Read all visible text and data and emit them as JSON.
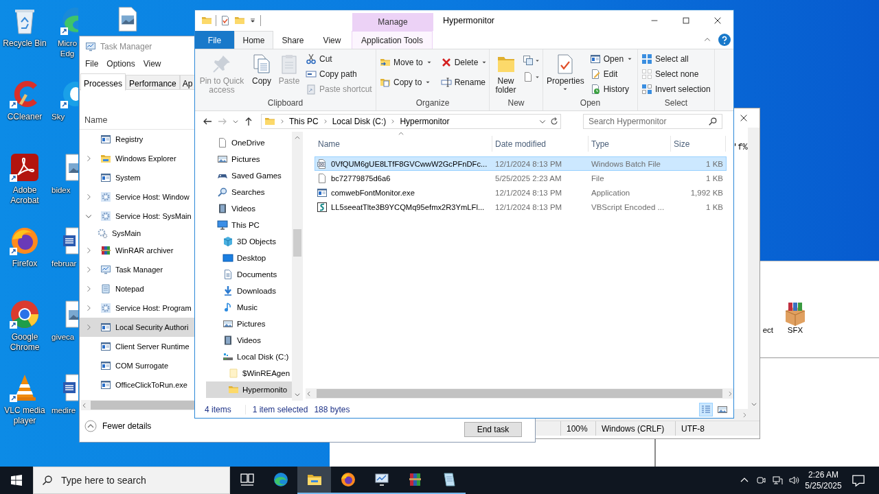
{
  "desktop": {
    "icons": [
      {
        "label": "Recycle Bin"
      },
      {
        "label": "CCleaner"
      },
      {
        "label": "Adobe Acrobat"
      },
      {
        "label": "Firefox"
      },
      {
        "label": "Google Chrome"
      },
      {
        "label": "VLC media player"
      }
    ],
    "column_2_icons": [
      {
        "label": "Micro Edg"
      },
      {
        "label": "Sky"
      },
      {
        "label": "bidex"
      },
      {
        "label": "februar"
      },
      {
        "label": "giveca"
      },
      {
        "label": "medire"
      }
    ]
  },
  "winrar": {
    "toolbar": [
      {
        "label": "ect"
      },
      {
        "label": "SFX"
      }
    ]
  },
  "notepad": {
    "text": "'f%",
    "status": [
      "100%",
      "Windows (CRLF)",
      "UTF-8"
    ]
  },
  "task_manager": {
    "title": "Task Manager",
    "menu": [
      "File",
      "Options",
      "View"
    ],
    "tabs": [
      {
        "label": "Processes",
        "selected": true
      },
      {
        "label": "Performance",
        "selected": false
      },
      {
        "label": "Ap",
        "selected": false
      }
    ],
    "column": "Name",
    "processes": [
      {
        "name": "Registry",
        "kind": "window",
        "selected": false
      },
      {
        "name": "Windows Explorer",
        "kind": "explorer",
        "expanded": false,
        "selected": false
      },
      {
        "name": "System",
        "kind": "window",
        "selected": false
      },
      {
        "name": "Service Host: Window",
        "kind": "service",
        "expanded": false,
        "selected": false
      },
      {
        "name": "Service Host: SysMain",
        "kind": "service",
        "expanded": true,
        "selected": false,
        "children": [
          {
            "name": "SysMain",
            "kind": "gear",
            "selected": false
          }
        ]
      },
      {
        "name": "WinRAR archiver",
        "kind": "archiver",
        "expanded": false,
        "selected": false
      },
      {
        "name": "Task Manager",
        "kind": "monitor",
        "expanded": false,
        "selected": false
      },
      {
        "name": "Notepad",
        "kind": "notepad",
        "expanded": false,
        "selected": false
      },
      {
        "name": "Service Host: Program",
        "kind": "service",
        "expanded": false,
        "selected": false
      },
      {
        "name": "Local Security Authori",
        "kind": "window",
        "expanded": false,
        "selected": true
      },
      {
        "name": "Client Server Runtime",
        "kind": "window",
        "selected": false
      },
      {
        "name": "COM Surrogate",
        "kind": "window",
        "selected": false
      },
      {
        "name": "OfficeClickToRun.exe",
        "kind": "window",
        "selected": false
      }
    ],
    "footer": "Fewer details",
    "button": "End task"
  },
  "explorer": {
    "context_tab": "Manage",
    "title": "Hypermonitor",
    "tabs": [
      {
        "label": "File",
        "kind": "file",
        "selected": false
      },
      {
        "label": "Home",
        "kind": "tab",
        "selected": true
      },
      {
        "label": "Share",
        "kind": "tab",
        "selected": false
      },
      {
        "label": "View",
        "kind": "tab",
        "selected": false
      },
      {
        "label": "Application Tools",
        "kind": "context",
        "selected": false
      }
    ],
    "ribbon": [
      {
        "label": "Clipboard",
        "commands": [
          {
            "label": "Pin to Quick access",
            "kind": "large",
            "disabled": true
          },
          {
            "label": "Copy",
            "kind": "large",
            "disabled": false
          },
          {
            "label": "Paste",
            "kind": "large",
            "disabled": true
          },
          {
            "label": "Cut",
            "kind": "small",
            "disabled": false
          },
          {
            "label": "Copy path",
            "kind": "small",
            "disabled": false
          },
          {
            "label": "Paste shortcut",
            "kind": "small",
            "disabled": true
          }
        ]
      },
      {
        "label": "Organize",
        "commands": [
          {
            "label": "Move to",
            "kind": "small",
            "dropdown": true,
            "disabled": false
          },
          {
            "label": "Copy to",
            "kind": "small",
            "dropdown": true,
            "disabled": false
          },
          {
            "label": "Delete",
            "kind": "small",
            "dropdown": true,
            "disabled": false
          },
          {
            "label": "Rename",
            "kind": "small",
            "disabled": false
          }
        ]
      },
      {
        "label": "New",
        "commands": [
          {
            "label": "New folder",
            "kind": "large",
            "disabled": false
          }
        ]
      },
      {
        "label": "Open",
        "commands": [
          {
            "label": "Properties",
            "kind": "large",
            "dropdown": true,
            "disabled": false
          },
          {
            "label": "Open",
            "kind": "small",
            "dropdown": true,
            "disabled": false
          },
          {
            "label": "Edit",
            "kind": "small",
            "disabled": false
          },
          {
            "label": "History",
            "kind": "small",
            "disabled": false
          }
        ]
      },
      {
        "label": "Select",
        "commands": [
          {
            "label": "Select all",
            "kind": "small",
            "disabled": false
          },
          {
            "label": "Select none",
            "kind": "small",
            "disabled": false
          },
          {
            "label": "Invert selection",
            "kind": "small",
            "disabled": false
          }
        ]
      }
    ],
    "back": {
      "disabled": false
    },
    "forward": {
      "disabled": true
    },
    "path": [
      "This PC",
      "Local Disk (C:)",
      "Hypermonitor"
    ],
    "search": {
      "placeholder": "Search Hypermonitor"
    },
    "nav_tree": [
      {
        "label": "OneDrive",
        "kind": "doc",
        "selected": false
      },
      {
        "label": "Pictures",
        "kind": "pictures",
        "selected": false
      },
      {
        "label": "Saved Games",
        "kind": "games",
        "selected": false
      },
      {
        "label": "Searches",
        "kind": "search",
        "selected": false
      },
      {
        "label": "Videos",
        "kind": "videos",
        "selected": false
      },
      {
        "label": "This PC",
        "kind": "pc",
        "selected": false,
        "children": [
          {
            "label": "3D Objects",
            "kind": "objects",
            "selected": false
          },
          {
            "label": "Desktop",
            "kind": "desktop",
            "selected": false
          },
          {
            "label": "Documents",
            "kind": "documents",
            "selected": false
          },
          {
            "label": "Downloads",
            "kind": "downloads",
            "selected": false
          },
          {
            "label": "Music",
            "kind": "music",
            "selected": false
          },
          {
            "label": "Pictures",
            "kind": "pictures",
            "selected": false
          },
          {
            "label": "Videos",
            "kind": "videos",
            "selected": false
          },
          {
            "label": "Local Disk (C:)",
            "kind": "disk",
            "selected": false,
            "children": [
              {
                "label": "$WinREAgen",
                "kind": "hidden-folder",
                "selected": false
              },
              {
                "label": "Hypermonito",
                "kind": "folder",
                "selected": true
              }
            ]
          }
        ]
      }
    ],
    "columns": [
      "Name",
      "Date modified",
      "Type",
      "Size"
    ],
    "files": [
      {
        "name": "0VfQUM6gUE8LTfF8GVCwwW2GcPFnDFc...",
        "date": "12/1/2024 8:13 PM",
        "type": "Windows Batch File",
        "size": "1 KB",
        "kind": "batch",
        "selected": true
      },
      {
        "name": "bc72779875d6a6",
        "date": "5/25/2025 2:23 AM",
        "type": "File",
        "size": "1 KB",
        "kind": "file",
        "selected": false
      },
      {
        "name": "comwebFontMonitor.exe",
        "date": "12/1/2024 8:13 PM",
        "type": "Application",
        "size": "1,992 KB",
        "kind": "exe",
        "selected": false
      },
      {
        "name": "LL5seeatTlte3B9YCQMq95efmx2R3YmLFl...",
        "date": "12/1/2024 8:13 PM",
        "type": "VBScript Encoded ...",
        "size": "1 KB",
        "kind": "script",
        "selected": false
      }
    ],
    "status": {
      "count": "4 items",
      "selection": "1 item selected",
      "size": "188 bytes"
    }
  },
  "taskbar": {
    "search": {
      "placeholder": "Type here to search"
    },
    "apps": [
      {
        "running": false,
        "active": false
      },
      {
        "running": false,
        "active": false
      },
      {
        "running": true,
        "active": true
      },
      {
        "running": true,
        "active": false
      },
      {
        "running": true,
        "active": false
      },
      {
        "running": true,
        "active": false
      },
      {
        "running": true,
        "active": false
      }
    ],
    "time": "2:26 AM",
    "date": "5/25/2025"
  }
}
